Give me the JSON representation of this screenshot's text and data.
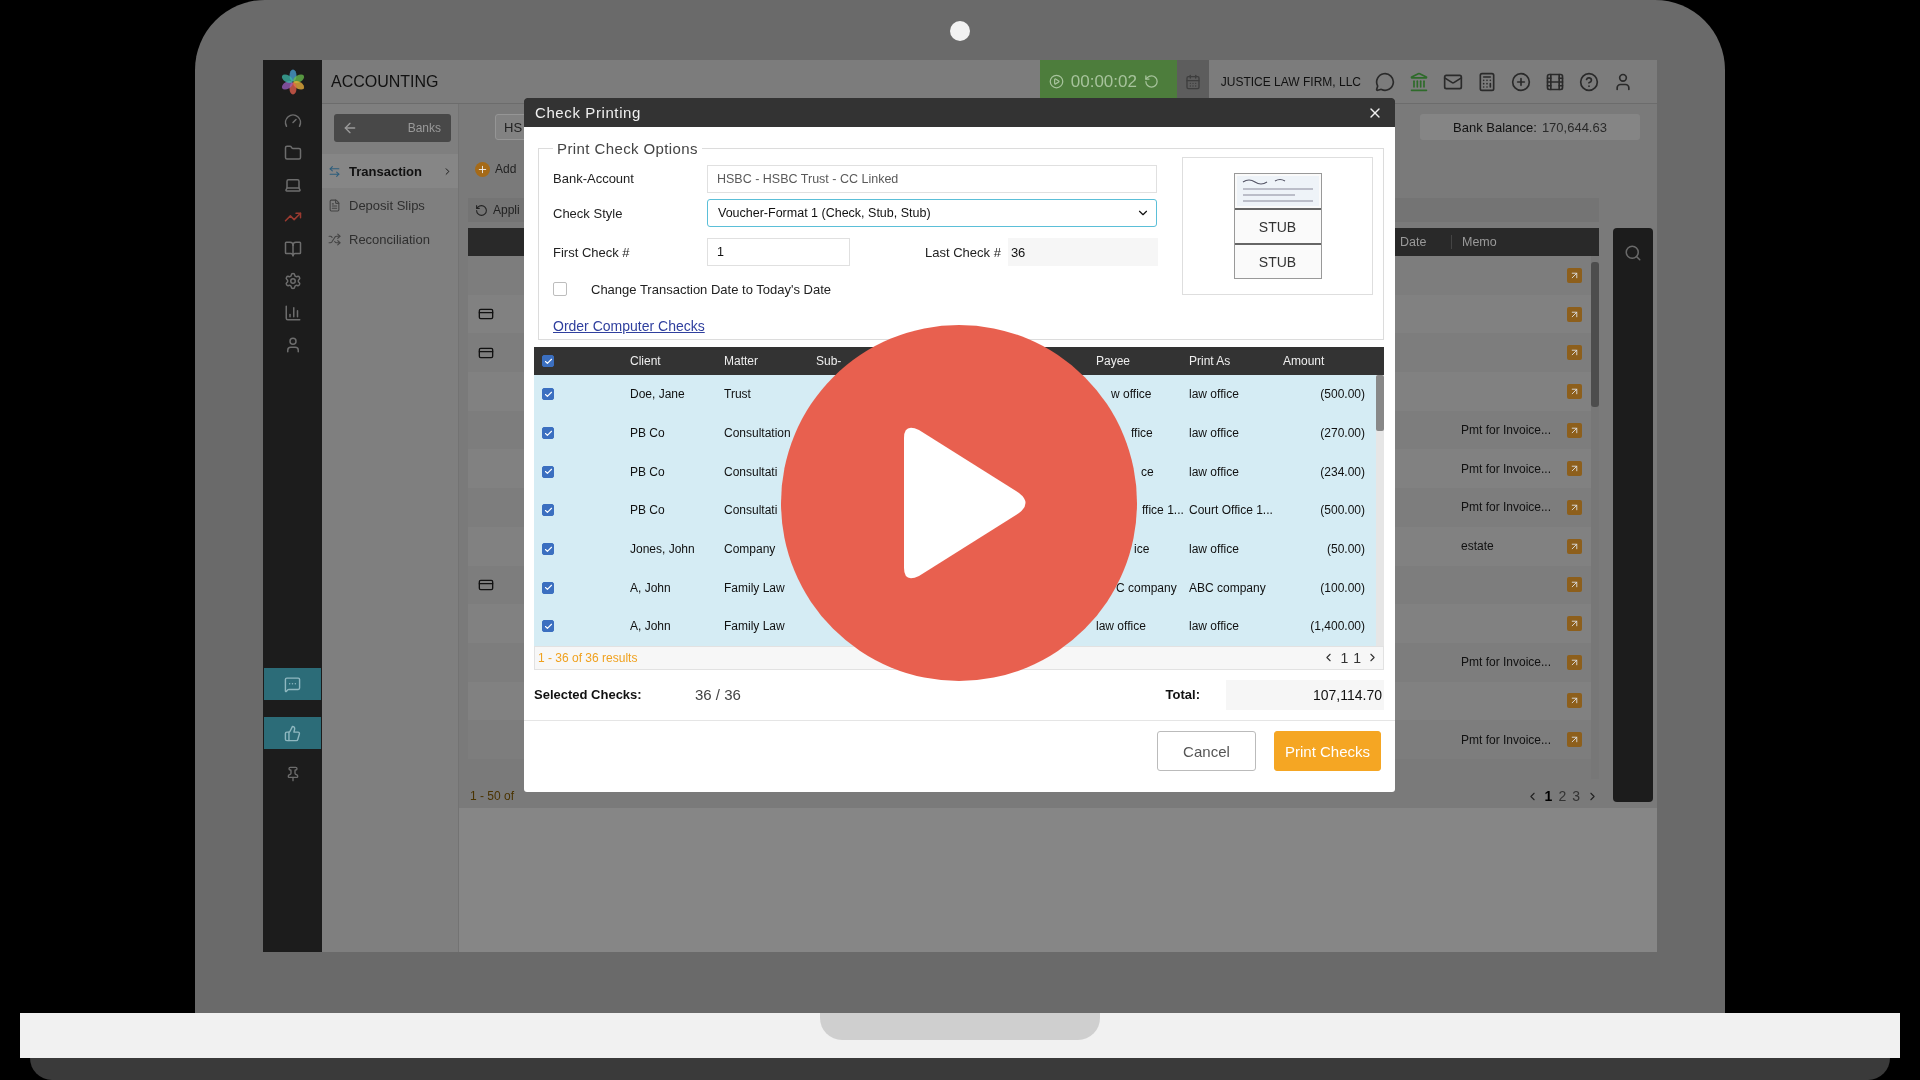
{
  "header": {
    "title": "ACCOUNTING",
    "timer": "00:00:02",
    "firm": "JUSTICE LAW FIRM, LLC"
  },
  "nav": {
    "back": "Banks",
    "items": [
      {
        "label": "Transaction",
        "selected": true,
        "submenu": true
      },
      {
        "label": "Deposit Slips",
        "selected": false,
        "submenu": false
      },
      {
        "label": "Reconciliation",
        "selected": false,
        "submenu": false
      }
    ]
  },
  "toolbar": {
    "account": "HS",
    "balance_label": "Bank Balance:",
    "balance": "170,644.63",
    "add": "Add",
    "apply": "Appli"
  },
  "register": {
    "columns": [
      "Date",
      "Memo"
    ],
    "rows": [
      {
        "card": false
      },
      {
        "card": true
      },
      {
        "card": true
      },
      {
        "card": false
      },
      {
        "card": false,
        "memo": "Pmt for Invoice..."
      },
      {
        "card": false,
        "memo": "Pmt for Invoice..."
      },
      {
        "card": false,
        "memo": "Pmt for Invoice..."
      },
      {
        "card": false,
        "memo": "estate"
      },
      {
        "card": true
      },
      {
        "card": false
      },
      {
        "card": false,
        "memo": "Pmt for Invoice..."
      },
      {
        "card": false
      },
      {
        "card": false,
        "memo": "Pmt for Invoice..."
      }
    ],
    "summary": "1 - 50 of",
    "pages": [
      {
        "label": "1",
        "selected": true
      },
      {
        "label": "2",
        "selected": false
      },
      {
        "label": "3",
        "selected": false
      }
    ]
  },
  "dialog": {
    "title": "Check Printing",
    "section": "Print Check Options",
    "bank_account": {
      "label": "Bank-Account",
      "value": "HSBC - HSBC Trust - CC Linked"
    },
    "check_style": {
      "label": "Check Style",
      "value": "Voucher-Format 1 (Check, Stub, Stub)"
    },
    "first_check": {
      "label": "First Check #",
      "value": "1"
    },
    "last_check": {
      "label": "Last Check #",
      "value": "36"
    },
    "change_date": {
      "label": "Change Transaction Date to Today's Date",
      "checked": false
    },
    "order_link": "Order Computer Checks",
    "stubs": [
      "STUB",
      "STUB"
    ],
    "table": {
      "all_checked": true,
      "columns": [
        "Client",
        "Matter",
        "Sub-",
        "Payee",
        "Print As",
        "Amount"
      ],
      "rows": [
        {
          "checked": true,
          "client": "Doe, Jane",
          "matter": "Trust",
          "payee": "w office",
          "print_as": "law office",
          "amount": "(500.00)"
        },
        {
          "checked": true,
          "client": "PB Co",
          "matter": "Consultation",
          "payee": "ffice",
          "print_as": "law office",
          "amount": "(270.00)"
        },
        {
          "checked": true,
          "client": "PB Co",
          "matter": "Consultati",
          "payee": "ce",
          "print_as": "law office",
          "amount": "(234.00)"
        },
        {
          "checked": true,
          "client": "PB Co",
          "matter": "Consultati",
          "payee": "ffice 1...",
          "print_as": "Court Office 1...",
          "amount": "(500.00)"
        },
        {
          "checked": true,
          "client": "Jones, John",
          "matter": "Company",
          "payee": "ice",
          "print_as": "law office",
          "amount": "(50.00)"
        },
        {
          "checked": true,
          "client": "A, John",
          "matter": "Family Law",
          "payee": "C company",
          "print_as": "ABC company",
          "amount": "(100.00)"
        },
        {
          "checked": true,
          "client": "A, John",
          "matter": "Family Law",
          "payee": "law office",
          "print_as": "law office",
          "amount": "(1,400.00)"
        }
      ],
      "summary": "1 - 36 of 36 results",
      "page": "1",
      "page_count": "1"
    },
    "selected_label": "Selected Checks:",
    "selected_value": "36 / 36",
    "total_label": "Total:",
    "total_value": "107,114.70",
    "buttons": [
      {
        "label": "Cancel",
        "kind": "secondary"
      },
      {
        "label": "Print Checks",
        "kind": "primary"
      }
    ]
  }
}
